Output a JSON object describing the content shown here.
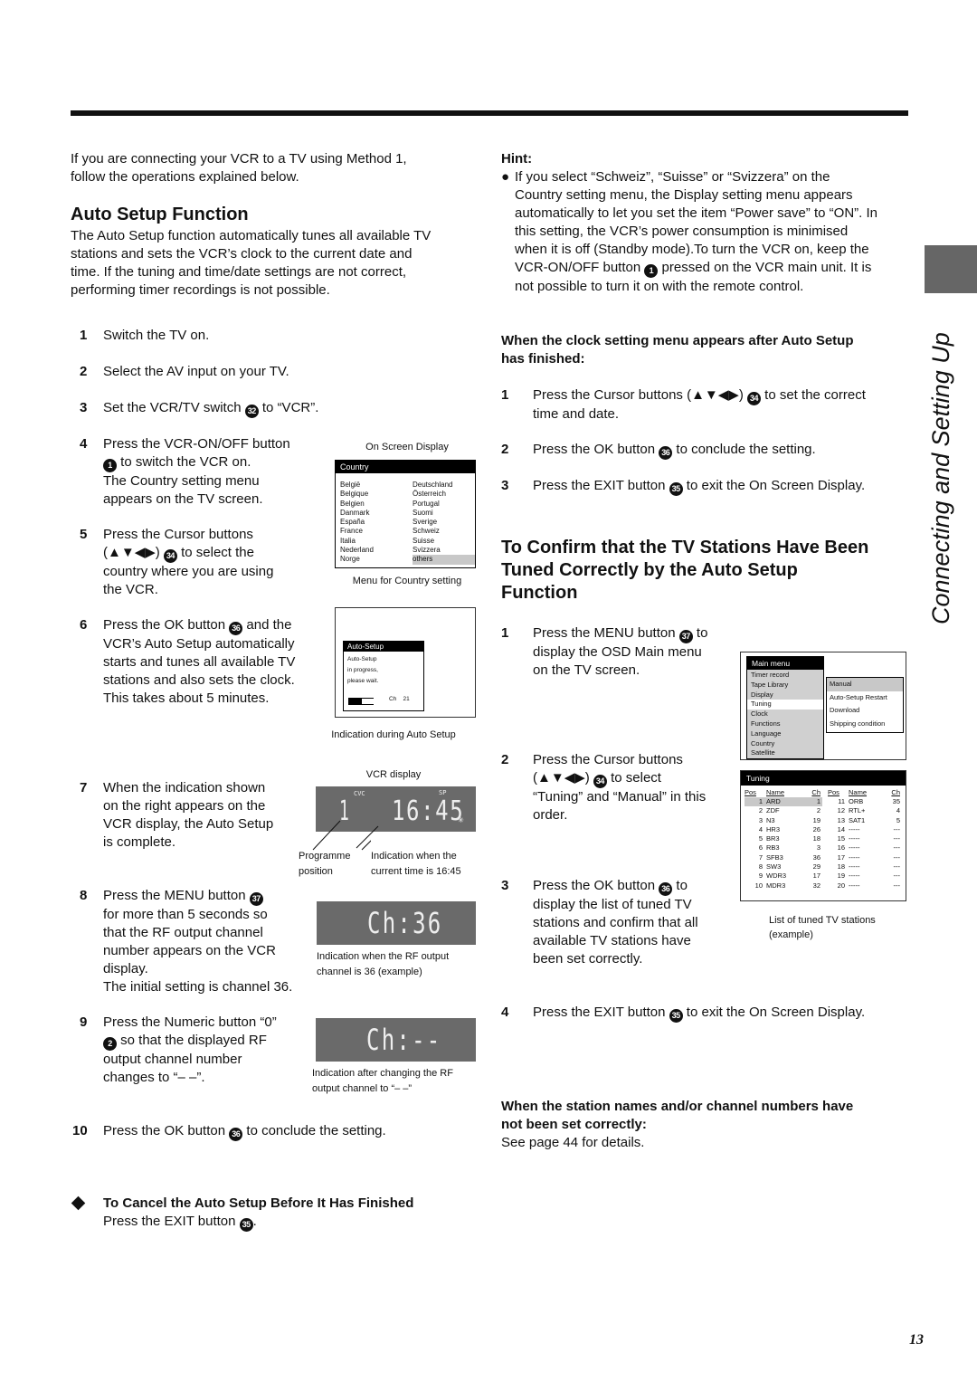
{
  "side_title": "Connecting and Setting Up",
  "page_number": "13",
  "intro": [
    "If you are connecting your VCR to a TV using Method 1,",
    "follow the operations explained below."
  ],
  "auto_setup": {
    "heading": "Auto Setup Function",
    "body": [
      "The Auto Setup function automatically tunes all available TV",
      "stations and sets the VCR’s clock to the current date and",
      "time. If the tuning and time/date settings are not correct,",
      "performing timer recordings is not possible."
    ]
  },
  "steps": [
    {
      "num": "1",
      "lines": [
        "Switch the TV on."
      ]
    },
    {
      "num": "2",
      "lines": [
        "Select the AV input on your TV."
      ]
    },
    {
      "num": "3",
      "pre": "Set the VCR/TV switch ",
      "ref": "32",
      "post": " to “VCR”."
    },
    {
      "num": "4",
      "l1": "Press the VCR-ON/OFF button",
      "ref": "1",
      "l2": " to switch the VCR on.",
      "l3": "The Country setting menu",
      "l4": "appears on the TV screen."
    },
    {
      "num": "5",
      "l1": "Press the Cursor buttons",
      "l2a": "(▲▼◀▶) ",
      "ref": "34",
      "l2b": " to select the",
      "l3": "country where you are using",
      "l4": "the VCR."
    },
    {
      "num": "6",
      "l1a": "Press the OK button ",
      "ref": "36",
      "l1b": " and the",
      "l2": "VCR’s Auto Setup automatically",
      "l3": "starts and tunes all available TV",
      "l4": "stations and also sets the clock.",
      "l5": "This takes about 5 minutes."
    },
    {
      "num": "7",
      "lines": [
        "When the indication shown",
        "on the right appears on the",
        "VCR display, the Auto Setup",
        "is complete."
      ]
    },
    {
      "num": "8",
      "l1a": "Press the MENU button ",
      "ref": "37",
      "l2": "for more than 5 seconds so",
      "l3": "that the RF output channel",
      "l4": "number appears on the VCR",
      "l5": "display.",
      "l6": "The initial setting is channel 36."
    },
    {
      "num": "9",
      "l1": "Press the Numeric button “0”",
      "ref": "2",
      "l2": " so that the displayed RF",
      "l3": "output channel number",
      "l4": "changes to “– –”."
    },
    {
      "num": "10",
      "pre": "Press the OK button ",
      "ref": "36",
      "post": " to conclude the setting."
    }
  ],
  "cancel": {
    "heading": "To Cancel the Auto Setup Before It Has Finished",
    "pre": "Press the EXIT button ",
    "ref": "35",
    "post": "."
  },
  "country_osd": {
    "label": "On Screen Display",
    "title": "Country",
    "col1": [
      "België",
      "Belgique",
      "Belgien",
      "Danmark",
      "España",
      "France",
      "Italia",
      "Nederland",
      "Norge"
    ],
    "col2": [
      "Deutschland",
      "Österreich",
      "Portugal",
      "Suomi",
      "Sverige",
      "Schweiz",
      "Suisse",
      "Svizzera",
      "others"
    ],
    "selected": "others",
    "caption": "Menu for Country setting"
  },
  "autosetup_osd": {
    "title": "Auto-Setup",
    "lines": [
      "Auto-Setup",
      "in progress,",
      "please wait."
    ],
    "progress_fraction": 0.5,
    "ch_label": "Ch",
    "ch_value": "21",
    "caption": "Indication during Auto Setup"
  },
  "vcr_display": {
    "label": "VCR display",
    "cvc": "CVC",
    "sp": "SP",
    "position": "1",
    "time": "16:45",
    "caption_left": [
      "Programme",
      "position"
    ],
    "caption_right": [
      "Indication when the",
      "current time is 16:45"
    ]
  },
  "rf_display": {
    "text": "Ch:36",
    "caption": [
      "Indication when the RF output",
      "channel is 36 (example)"
    ]
  },
  "rf_changed_display": {
    "text": "Ch:--",
    "caption": [
      "Indication after changing the RF",
      "output channel to  “– –”"
    ]
  },
  "hint": {
    "label": "Hint:",
    "lines": [
      "If you select “Schweiz”, “Suisse” or “Svizzera” on the",
      "Country setting menu, the Display setting menu appears",
      "automatically to let you set the item “Power save” to “ON”. In",
      "this setting, the VCR’s power consumption is minimised",
      "when it is off (Standby mode).To turn the VCR on, keep the"
    ],
    "l6a": "VCR-ON/OFF button ",
    "ref": "1",
    "l6b": " pressed on the VCR main unit. It is",
    "l7": "not possible to turn it on with the remote control."
  },
  "clock": {
    "heading": [
      "When the clock setting menu appears after Auto Setup",
      "has finished:"
    ],
    "steps": [
      {
        "num": "1",
        "pre": "Press the Cursor buttons (▲▼◀▶) ",
        "ref": "34",
        "post": " to set the correct",
        "l2": "time and date."
      },
      {
        "num": "2",
        "pre": "Press the OK button ",
        "ref": "36",
        "post": " to conclude the setting."
      },
      {
        "num": "3",
        "pre": "Press the EXIT button ",
        "ref": "35",
        "post": " to exit the On Screen Display."
      }
    ]
  },
  "confirm": {
    "heading": [
      "To Confirm that the TV Stations Have Been",
      "Tuned Correctly by the Auto Setup",
      "Function"
    ],
    "steps": [
      {
        "num": "1",
        "pre": "Press the MENU button ",
        "ref": "37",
        "post": " to",
        "l2": "display the OSD Main menu",
        "l3": "on the TV screen."
      },
      {
        "num": "2",
        "l1": "Press the Cursor buttons",
        "l2a": "(▲▼◀▶) ",
        "ref": "34",
        "l2b": " to select",
        "l3": "“Tuning” and “Manual” in this",
        "l4": "order."
      },
      {
        "num": "3",
        "pre": "Press the OK button ",
        "ref": "36",
        "post": " to",
        "l2": "display the list of tuned TV",
        "l3": "stations and confirm that all",
        "l4": "available TV stations have",
        "l5": "been set correctly."
      },
      {
        "num": "4",
        "pre": "Press the EXIT button ",
        "ref": "35",
        "post": " to exit the On Screen Display."
      }
    ]
  },
  "main_menu_osd": {
    "title": "Main menu",
    "items": [
      "Timer record",
      "Tape Library",
      "Display",
      "Tuning",
      "Clock",
      "Functions",
      "Language",
      "Country",
      "Satellite"
    ],
    "selected": "Tuning",
    "submenu": [
      "Manual",
      "Auto-Setup Restart",
      "Download",
      "Shipping condition"
    ],
    "submenu_selected": "Manual"
  },
  "tuning_osd": {
    "title": "Tuning",
    "headers": [
      "Pos",
      "Name",
      "Ch"
    ],
    "left": [
      [
        "1",
        "ARD",
        "1"
      ],
      [
        "2",
        "ZDF",
        "2"
      ],
      [
        "3",
        "N3",
        "19"
      ],
      [
        "4",
        "HR3",
        "26"
      ],
      [
        "5",
        "BR3",
        "18"
      ],
      [
        "6",
        "RB3",
        "3"
      ],
      [
        "7",
        "SFB3",
        "36"
      ],
      [
        "8",
        "SW3",
        "29"
      ],
      [
        "9",
        "WDR3",
        "17"
      ],
      [
        "10",
        "MDR3",
        "32"
      ]
    ],
    "right": [
      [
        "11",
        "ORB",
        "35"
      ],
      [
        "12",
        "RTL+",
        "4"
      ],
      [
        "13",
        "SAT1",
        "5"
      ],
      [
        "14",
        "-----",
        "---"
      ],
      [
        "15",
        "-----",
        "---"
      ],
      [
        "16",
        "-----",
        "---"
      ],
      [
        "17",
        "-----",
        "---"
      ],
      [
        "18",
        "-----",
        "---"
      ],
      [
        "19",
        "-----",
        "---"
      ],
      [
        "20",
        "-----",
        "---"
      ]
    ],
    "caption": [
      "List of tuned TV stations",
      "(example)"
    ]
  },
  "wrong": {
    "heading": [
      "When the station names and/or channel numbers have",
      "not been set correctly:"
    ],
    "text": "See page 44 for details."
  }
}
